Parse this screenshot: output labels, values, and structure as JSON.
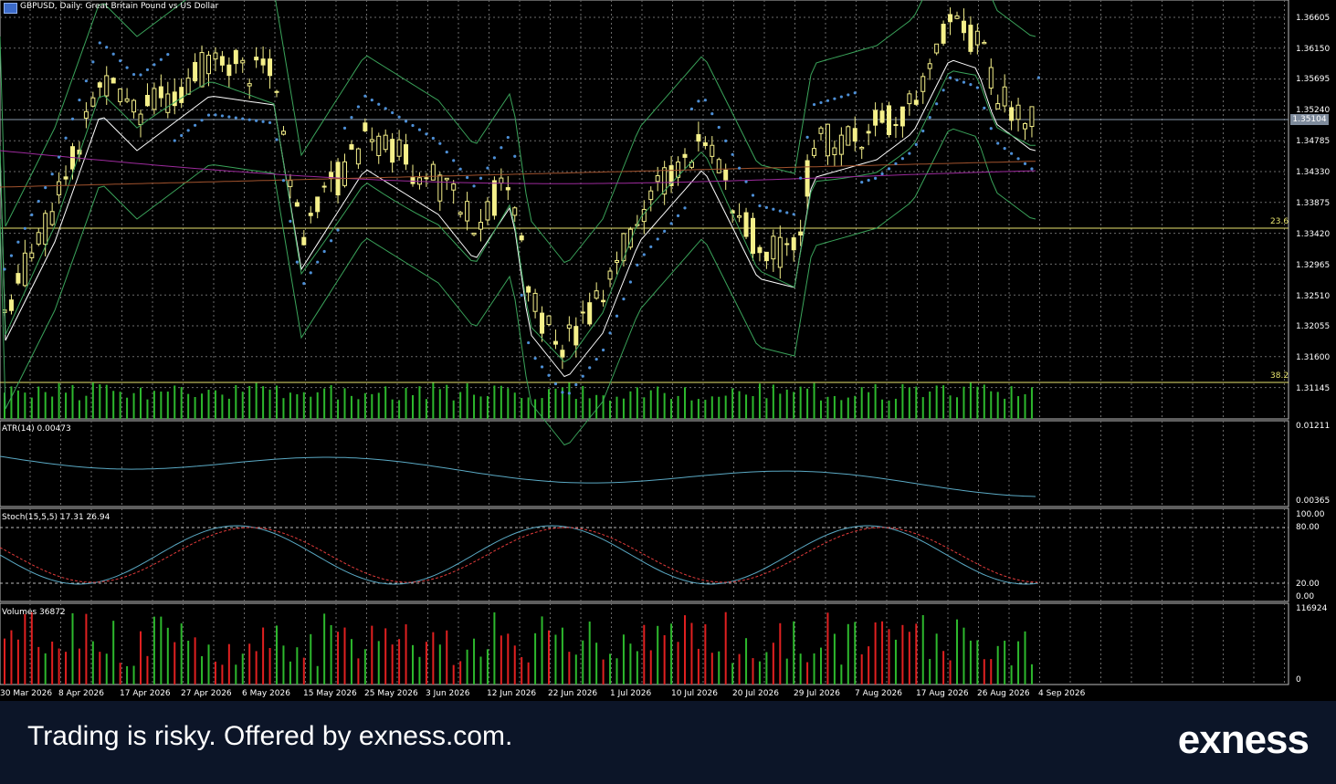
{
  "chart": {
    "title": "GBPUSD, Daily:  Great Britain Pound vs US Dollar",
    "current_price": "1.35104",
    "price_labels": [
      "1.36605",
      "1.36150",
      "1.35695",
      "1.35240",
      "1.34785",
      "1.34330",
      "1.33875",
      "1.33420",
      "1.32965",
      "1.32510",
      "1.32055",
      "1.31600",
      "1.31145"
    ],
    "fib_labels": {
      "fib_236": "23.6",
      "fib_382": "38.2"
    },
    "atr_label": "ATR(14) 0.00473",
    "atr_scale": [
      "0.01211",
      "0.00365"
    ],
    "stoch_label": "Stoch(15,5,5) 17.31 26.94",
    "stoch_scale": [
      "100.00",
      "80.00",
      "20.00",
      "0.00"
    ],
    "volumes_label": "Volumes 36872",
    "volumes_scale": [
      "116924",
      "0"
    ],
    "dates": [
      "30 Mar 2026",
      "8 Apr 2026",
      "17 Apr 2026",
      "27 Apr 2026",
      "6 May 2026",
      "15 May 2026",
      "25 May 2026",
      "3 Jun 2026",
      "12 Jun 2026",
      "22 Jun 2026",
      "1 Jul 2026",
      "10 Jul 2026",
      "20 Jul 2026",
      "29 Jul 2026",
      "7 Aug 2026",
      "17 Aug 2026",
      "26 Aug 2026",
      "4 Sep 2026"
    ],
    "colors": {
      "candle": "#f5f08a",
      "grid": "#6b6b6b",
      "bb": "#3aa35a",
      "sma": "#ffffff",
      "psar": "#4d8fd6",
      "ma_purple": "#9c2a9c",
      "ma_brown": "#a0522d",
      "atr": "#5aa9c4",
      "stoch_main": "#5aa9c4",
      "stoch_signal": "#e23b3b",
      "vol_up": "#2db82d",
      "vol_down": "#e02020",
      "fib": "#e8e46e"
    }
  },
  "footer": {
    "text": "Trading is risky. Offered by exness.com.",
    "logo": "exness"
  }
}
